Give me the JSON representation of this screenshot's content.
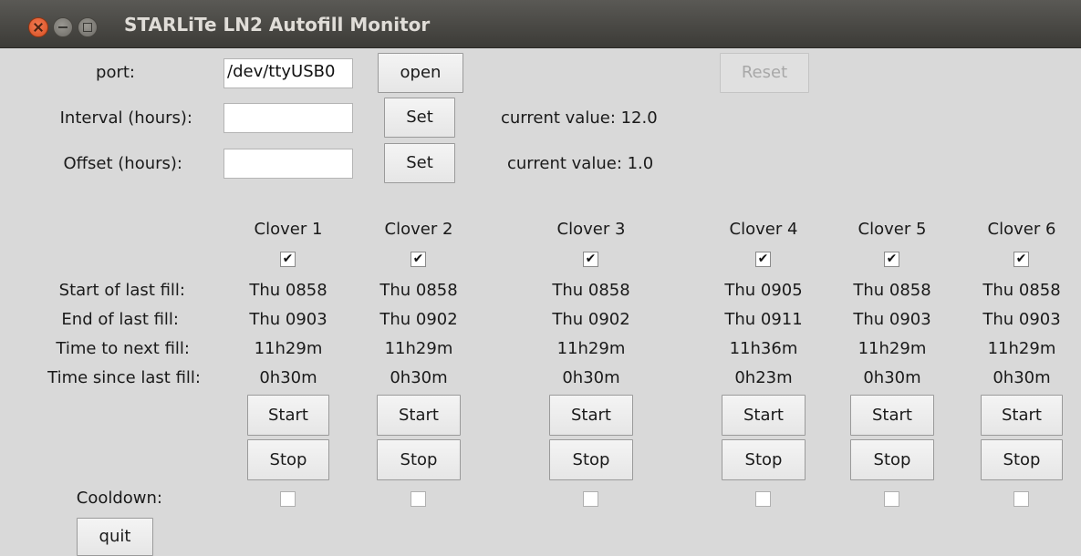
{
  "window": {
    "title": "STARLiTe LN2 Autofill Monitor"
  },
  "port": {
    "label": "port:",
    "value": "/dev/ttyUSB0",
    "open_label": "open",
    "reset_label": "Reset"
  },
  "interval": {
    "label": "Interval (hours):",
    "value": "",
    "set_label": "Set",
    "current": "current value: 12.0"
  },
  "offset": {
    "label": "Offset (hours):",
    "value": "",
    "set_label": "Set",
    "current": "current value: 1.0"
  },
  "row_labels": {
    "start": "Start of last fill:",
    "end": "End of last fill:",
    "next": "Time to next fill:",
    "since": "Time since last fill:",
    "cooldown": "Cooldown:"
  },
  "clovers": [
    {
      "name": "Clover 1",
      "enabled": true,
      "start": "Thu 0858",
      "end": "Thu 0903",
      "next": "11h29m",
      "since": "0h30m",
      "start_label": "Start",
      "stop_label": "Stop",
      "cooldown": false
    },
    {
      "name": "Clover 2",
      "enabled": true,
      "start": "Thu 0858",
      "end": "Thu 0902",
      "next": "11h29m",
      "since": "0h30m",
      "start_label": "Start",
      "stop_label": "Stop",
      "cooldown": false
    },
    {
      "name": "Clover 3",
      "enabled": true,
      "start": "Thu 0858",
      "end": "Thu 0902",
      "next": "11h29m",
      "since": "0h30m",
      "start_label": "Start",
      "stop_label": "Stop",
      "cooldown": false
    },
    {
      "name": "Clover 4",
      "enabled": true,
      "start": "Thu 0905",
      "end": "Thu 0911",
      "next": "11h36m",
      "since": "0h23m",
      "start_label": "Start",
      "stop_label": "Stop",
      "cooldown": false
    },
    {
      "name": "Clover 5",
      "enabled": true,
      "start": "Thu 0858",
      "end": "Thu 0903",
      "next": "11h29m",
      "since": "0h30m",
      "start_label": "Start",
      "stop_label": "Stop",
      "cooldown": false
    },
    {
      "name": "Clover 6",
      "enabled": true,
      "start": "Thu 0858",
      "end": "Thu 0903",
      "next": "11h29m",
      "since": "0h30m",
      "start_label": "Start",
      "stop_label": "Stop",
      "cooldown": false
    }
  ],
  "quit_label": "quit",
  "check_glyph": "✔"
}
